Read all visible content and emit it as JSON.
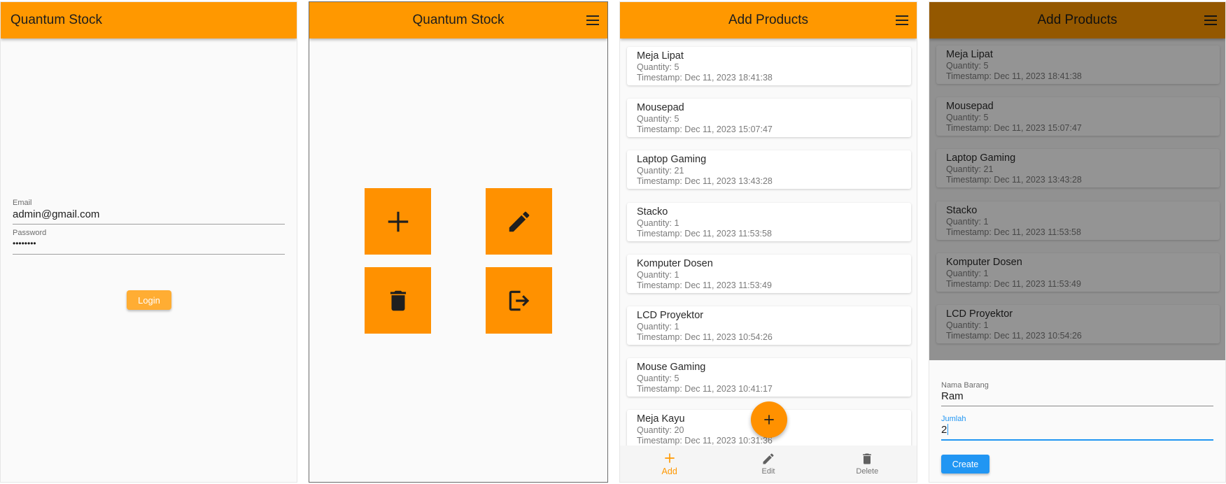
{
  "login_screen": {
    "title": "Quantum Stock",
    "email": {
      "label": "Email",
      "value": "admin@gmail.com"
    },
    "password": {
      "label": "Password",
      "value": "••••••••"
    },
    "login_label": "Login"
  },
  "menu_screen": {
    "title": "Quantum Stock",
    "tiles": [
      {
        "icon": "add-icon"
      },
      {
        "icon": "edit-icon"
      },
      {
        "icon": "delete-icon"
      },
      {
        "icon": "logout-icon"
      }
    ]
  },
  "products_screen": {
    "title": "Add Products",
    "products": [
      {
        "name": "Meja Lipat",
        "quantity": "Quantity: 5",
        "timestamp": "Timestamp: Dec 11, 2023 18:41:38"
      },
      {
        "name": "Mousepad",
        "quantity": "Quantity: 5",
        "timestamp": "Timestamp: Dec 11, 2023 15:07:47"
      },
      {
        "name": "Laptop Gaming",
        "quantity": "Quantity: 21",
        "timestamp": "Timestamp: Dec 11, 2023 13:43:28"
      },
      {
        "name": "Stacko",
        "quantity": "Quantity: 1",
        "timestamp": "Timestamp: Dec 11, 2023 11:53:58"
      },
      {
        "name": "Komputer Dosen",
        "quantity": "Quantity: 1",
        "timestamp": "Timestamp: Dec 11, 2023 11:53:49"
      },
      {
        "name": "LCD Proyektor",
        "quantity": "Quantity: 1",
        "timestamp": "Timestamp: Dec 11, 2023 10:54:26"
      },
      {
        "name": "Mouse Gaming",
        "quantity": "Quantity: 5",
        "timestamp": "Timestamp: Dec 11, 2023 10:41:17"
      },
      {
        "name": "Meja Kayu",
        "quantity": "Quantity: 20",
        "timestamp": "Timestamp: Dec 11, 2023 10:31:36"
      }
    ],
    "nav": [
      {
        "label": "Add",
        "icon": "add-icon",
        "active": true
      },
      {
        "label": "Edit",
        "icon": "edit-icon",
        "active": false
      },
      {
        "label": "Delete",
        "icon": "delete-icon",
        "active": false
      }
    ]
  },
  "create_sheet": {
    "title": "Add Products",
    "name_field": {
      "label": "Nama Barang",
      "value": "Ram"
    },
    "qty_field": {
      "label": "Jumlah",
      "value": "2"
    },
    "create_label": "Create"
  },
  "colors": {
    "primary": "#ff9800",
    "tile": "#ff9100",
    "accent_blue": "#2196f3",
    "background": "#fafafa"
  }
}
